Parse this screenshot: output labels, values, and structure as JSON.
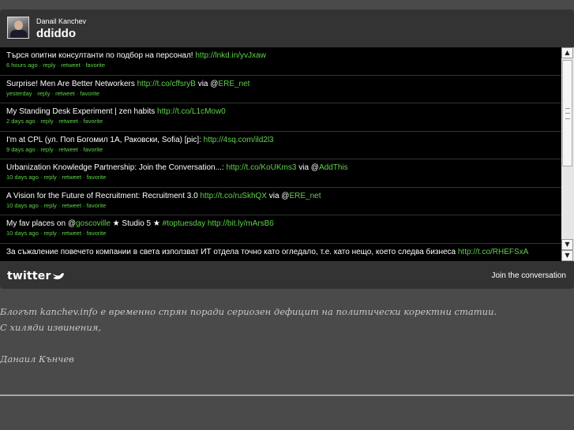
{
  "header": {
    "user_name": "Danail Kanchev",
    "screen_name": "ddiddo"
  },
  "tweets": [
    {
      "text": "Търся опитни консултанти по подбор на персонал! ",
      "link": "http://lnkd.in/yvJxaw",
      "tail": "",
      "mention": "",
      "time": "6 hours ago",
      "actions": " · reply · retweet · favorite"
    },
    {
      "text": "Surprise! Men Are Better Networkers ",
      "link": "http://t.co/cffsryB",
      "tail": " via @",
      "mention": "ERE_net",
      "time": "yesterday",
      "actions": " · reply · retweet · favorite"
    },
    {
      "text": "My Standing Desk Experiment | zen habits ",
      "link": "http://t.co/L1cMow0",
      "tail": "",
      "mention": "",
      "time": "2 days ago",
      "actions": " · reply · retweet · favorite"
    },
    {
      "text": "I'm at CPL (ул. Поп Богомил 1А, Раковски, Sofia) [pic]: ",
      "link": "http://4sq.com/ild2l3",
      "tail": "",
      "mention": "",
      "time": "9 days ago",
      "actions": " · reply · retweet · favorite"
    },
    {
      "text": "Urbanization Knowledge Partnership: Join the Conversation...: ",
      "link": "http://t.co/KoUKms3",
      "tail": " via @",
      "mention": "AddThis",
      "time": "10 days ago",
      "actions": " · reply · retweet · favorite"
    },
    {
      "text": "A Vision for the Future of Recruitment: Recruitment 3.0 ",
      "link": "http://t.co/ruSkhQX",
      "tail": " via @",
      "mention": "ERE_net",
      "time": "10 days ago",
      "actions": " · reply · retweet · favorite"
    },
    {
      "text": "My fav places on @",
      "link": "goscoville",
      "tail": " ★ Studio 5 ★ ",
      "mention": "#toptuesday http://bit.ly/mArsB6",
      "time": "10 days ago",
      "actions": " · reply · retweet · favorite"
    },
    {
      "text": "За съжаление повечето компании в света използват ИТ отдела точно като огледало, т.е. като нещо, което следва бизнеса ",
      "link": "http://t.co/RHEFSxA",
      "tail": "",
      "mention": "",
      "time": "",
      "actions": ""
    }
  ],
  "scrollbar": {
    "up": "▲",
    "down": "▼"
  },
  "footer": {
    "logo": "twitter",
    "join": "Join the conversation"
  },
  "blog": {
    "line1": "Блогът kanchev.info е временно спрян поради сериозен дефицит на политически коректни статии.",
    "line2": "С хиляди извинения,",
    "line3": "Данаил Кънчев"
  }
}
